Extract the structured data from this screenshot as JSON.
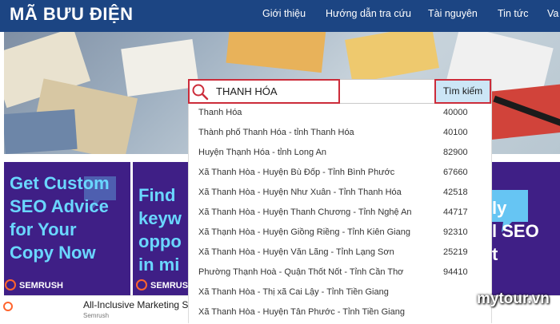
{
  "header": {
    "logo": "MÃ BƯU ĐIỆN",
    "nav": [
      "Giới thiệu",
      "Hướng dẫn tra cứu",
      "Tài nguyên",
      "Tin tức",
      "Va"
    ]
  },
  "search": {
    "value": "THANH HÓA",
    "button_label": "Tìm kiếm",
    "icon": "search-icon"
  },
  "results": [
    {
      "name": "Thanh Hóa",
      "code": "40000"
    },
    {
      "name": "Thành phố Thanh Hóa - tỉnh Thanh Hóa",
      "code": "40100"
    },
    {
      "name": "Huyện Thạnh Hóa - tỉnh Long An",
      "code": "82900"
    },
    {
      "name": "Xã Thanh Hòa - Huyện Bù Đốp - Tỉnh Bình Phước",
      "code": "67660"
    },
    {
      "name": "Xã Thanh Hòa - Huyện Như Xuân - Tỉnh Thanh Hóa",
      "code": "42518"
    },
    {
      "name": "Xã Thanh Hòa - Huyện Thanh Chương - Tỉnh Nghệ An",
      "code": "44717"
    },
    {
      "name": "Xã Thạnh Hòa - Huyện Giồng Riềng - Tỉnh Kiên Giang",
      "code": "92310"
    },
    {
      "name": "Xã Thanh Hòa - Huyện Văn Lãng - Tỉnh Lạng Sơn",
      "code": "25219"
    },
    {
      "name": "Phường Thạnh Hoà - Quận Thốt Nốt - Tỉnh Cần Thơ",
      "code": "94410"
    },
    {
      "name": "Xã Thanh Hòa - Thị xã Cai Lậy - Tỉnh Tiền Giang",
      "code": ""
    },
    {
      "name": "Xã Thanh Hòa - Huyện Tân Phước - Tỉnh Tiền Giang",
      "code": ""
    }
  ],
  "ads": {
    "left_text": "Get Custom\nSEO Advice\nfor Your\nCopy Now",
    "middle_text": "Find\nkeyw\noppo\nin mi",
    "right_text": "ly\nl SEO\nt",
    "brand": "SEMRUSH",
    "strip_title": "All-Inclusive Marketing S",
    "strip_sub": "Semrush"
  },
  "watermark": "mytour.vn",
  "colors": {
    "header_bg": "#1c4583",
    "ad_bg": "#3f1f86",
    "ad_text": "#6ad7ff",
    "highlight": "#cc2c3a",
    "button_bg": "#cce6f6"
  }
}
